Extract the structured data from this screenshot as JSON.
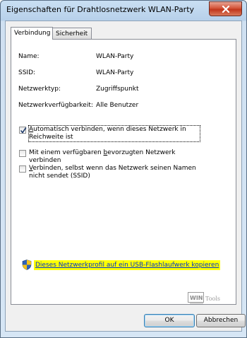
{
  "window": {
    "title": "Eigenschaften für Drahtlosnetzwerk WLAN-Party"
  },
  "tabs": [
    {
      "label": "Verbindung",
      "active": true
    },
    {
      "label": "Sicherheit",
      "active": false
    }
  ],
  "properties": [
    {
      "label": "Name:",
      "value": "WLAN-Party"
    },
    {
      "label": "SSID:",
      "value": "WLAN-Party"
    },
    {
      "label": "Netzwerktyp:",
      "value": "Zugriffspunkt"
    },
    {
      "label": "Netzwerkverfügbarkeit:",
      "value": "Alle Benutzer"
    }
  ],
  "options": [
    {
      "pre": "",
      "accel": "A",
      "post": "utomatisch verbinden, wenn dieses Netzwerk in Reichweite ist",
      "checked": true
    },
    {
      "pre": "Mit einem verfügbaren ",
      "accel": "b",
      "post": "evorzugten Netzwerk verbinden",
      "checked": false
    },
    {
      "pre": "",
      "accel": "V",
      "post": "erbinden, selbst wenn das Netzwerk seinen Namen nicht sendet (SSID)",
      "checked": false
    }
  ],
  "link": {
    "text": "Dieses Netzwerkprofil auf ein USB-Flashlaufwerk kopieren"
  },
  "watermark": {
    "text": "WIN Tools"
  },
  "buttons": {
    "ok": "OK",
    "cancel": "Abbrechen"
  },
  "colors": {
    "link_highlight": "#ffff00",
    "link_text": "#0033cc",
    "close_button": "#c1361c"
  }
}
